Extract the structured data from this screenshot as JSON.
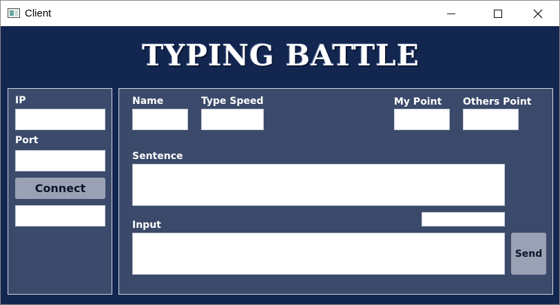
{
  "window": {
    "title": "Client",
    "icon": "window-app-icon",
    "controls": [
      "minimize-icon",
      "maximize-icon",
      "close-icon"
    ]
  },
  "app": {
    "title": "TYPING BATTLE",
    "colors": {
      "background": "#13264f",
      "panel": "#3b4a6a",
      "button": "#9aa1b4"
    }
  },
  "connection": {
    "ip_label": "IP",
    "ip_value": "",
    "port_label": "Port",
    "port_value": "",
    "connect_label": "Connect",
    "status_value": ""
  },
  "game": {
    "name_label": "Name",
    "name_value": "",
    "type_speed_label": "Type Speed",
    "type_speed_value": "",
    "my_point_label": "My Point",
    "my_point_value": "",
    "others_point_label": "Others Point",
    "others_point_value": "",
    "sentence_label": "Sentence",
    "sentence_value": "",
    "timer_value": "",
    "input_label": "Input",
    "input_value": "",
    "send_label": "Send"
  }
}
